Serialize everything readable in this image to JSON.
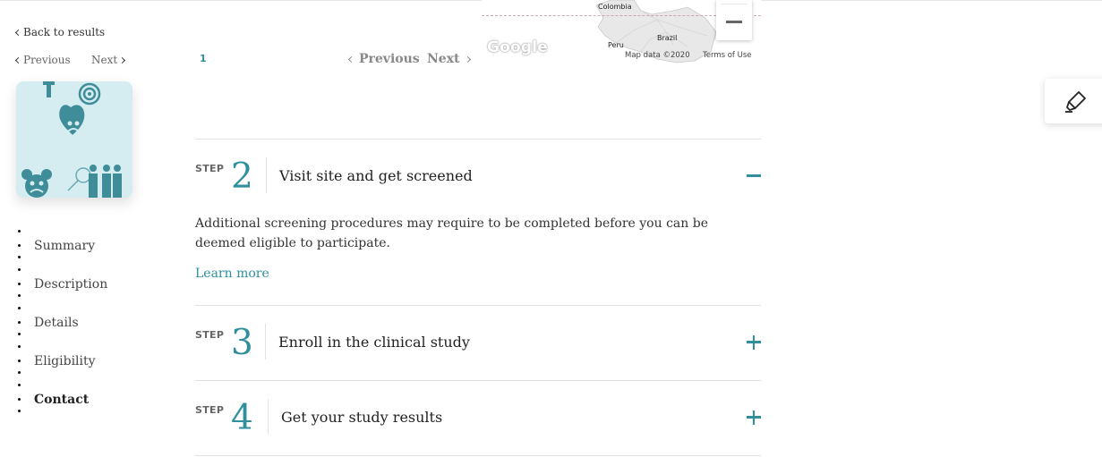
{
  "sidebar": {
    "back_label": "Back to results",
    "prev_label": "Previous",
    "next_label": "Next",
    "nav_items": [
      {
        "label": "Summary",
        "active": false
      },
      {
        "label": "Description",
        "active": false
      },
      {
        "label": "Details",
        "active": false
      },
      {
        "label": "Eligibility",
        "active": false
      },
      {
        "label": "Contact",
        "active": true
      }
    ]
  },
  "pagination": {
    "current_page": "1",
    "prev_label": "Previous",
    "next_label": "Next"
  },
  "map": {
    "labels": {
      "colombia": "Colombia",
      "peru": "Peru",
      "brazil": "Brazil"
    },
    "logo": "Google",
    "data_label": "Map data ©2020",
    "terms_label": "Terms of Use"
  },
  "steps": [
    {
      "step_word": "STEP",
      "number": "2",
      "title": "Visit site and get screened",
      "expanded": true,
      "description": "Additional screening procedures may require to be completed before you can be deemed eligible to participate.",
      "link_label": "Learn more"
    },
    {
      "step_word": "STEP",
      "number": "3",
      "title": "Enroll in the clinical study",
      "expanded": false
    },
    {
      "step_word": "STEP",
      "number": "4",
      "title": "Get your study results",
      "expanded": false
    }
  ],
  "colors": {
    "accent": "#2f8f9d",
    "card_bg": "#d5edf1"
  }
}
